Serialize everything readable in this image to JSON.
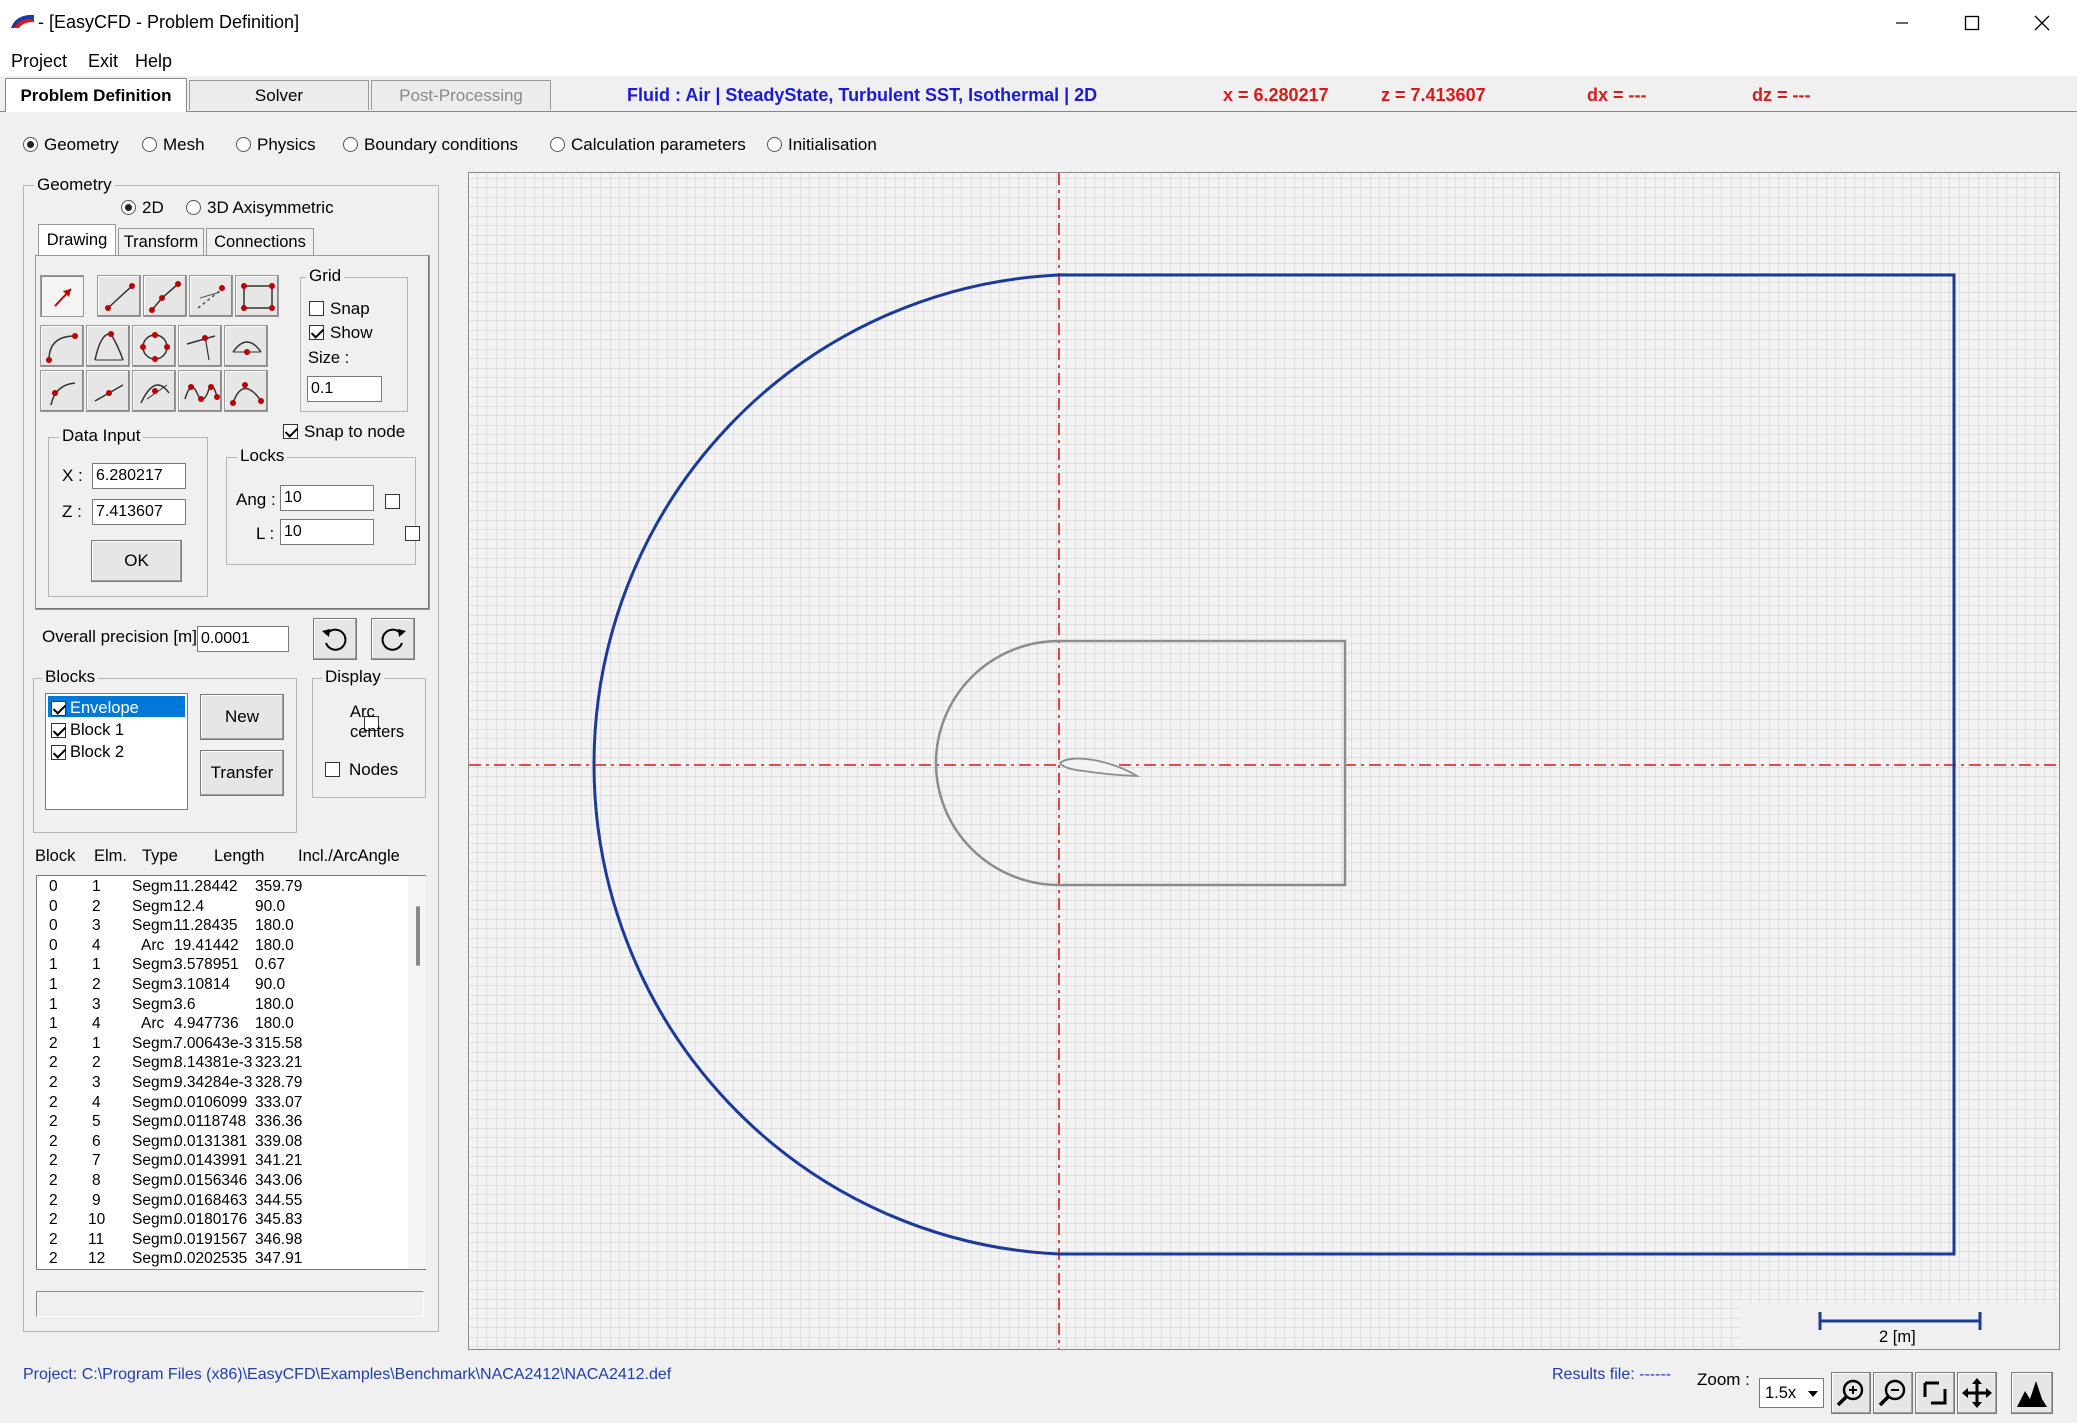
{
  "window": {
    "title": " - [EasyCFD - Problem Definition]",
    "minimize_icon": "minimize-icon",
    "maximize_icon": "maximize-icon",
    "close_icon": "close-icon"
  },
  "menubar": {
    "items": [
      "Project",
      "Exit",
      "Help"
    ]
  },
  "main_tabs": [
    {
      "label": "Problem Definition",
      "state": "active"
    },
    {
      "label": "Solver",
      "state": "normal"
    },
    {
      "label": "Post-Processing",
      "state": "disabled"
    }
  ],
  "status": {
    "fluid_info": "Fluid : Air  |  SteadyState, Turbulent SST, Isothermal  |  2D",
    "x": "x = 6.280217",
    "z": "z = 7.413607",
    "dx": "dx = ---",
    "dz": "dz = ---",
    "info_color": "#1a1ad8",
    "coord_color": "#d81a1a"
  },
  "sections": [
    {
      "label": "Geometry",
      "selected": true
    },
    {
      "label": "Mesh",
      "selected": false
    },
    {
      "label": "Physics",
      "selected": false
    },
    {
      "label": "Boundary conditions",
      "selected": false
    },
    {
      "label": "Calculation parameters",
      "selected": false
    },
    {
      "label": "Initialisation",
      "selected": false
    }
  ],
  "geometry": {
    "group_title": "Geometry",
    "mode_2d": "2D",
    "mode_3d": "3D Axisymmetric",
    "subtabs": [
      "Drawing",
      "Transform",
      "Connections"
    ],
    "tools": [
      "pointer-arrow-icon",
      "line-icon",
      "polyline-icon",
      "dashed-line-icon",
      "rectangle-icon",
      "arc-icon",
      "arc-three-point-icon",
      "circle-icon",
      "tangent-line-icon",
      "half-circle-icon",
      "curve-icon",
      "line-point-icon",
      "arc-through-icon",
      "spline-icon",
      "bezier-icon"
    ],
    "grid": {
      "title": "Grid",
      "snap_label": "Snap",
      "snap": false,
      "show_label": "Show",
      "show": true,
      "size_label": "Size :",
      "size_value": "0.1"
    },
    "snap_to_node_label": "Snap to node",
    "data_input": {
      "title": "Data Input",
      "x_label": "X :",
      "x_value": "6.280217",
      "z_label": "Z :",
      "z_value": "7.413607",
      "ok_label": "OK"
    },
    "locks": {
      "title": "Locks",
      "ang_label": "Ang :",
      "ang_value": "10",
      "l_label": "L :",
      "l_value": "10"
    }
  },
  "precision": {
    "label": "Overall precision [m] :",
    "value": "0.0001"
  },
  "blocks": {
    "title": "Blocks",
    "items": [
      {
        "name": "Envelope",
        "checked": true,
        "selected": true
      },
      {
        "name": "Block 1",
        "checked": true,
        "selected": false
      },
      {
        "name": "Block 2",
        "checked": true,
        "selected": false
      }
    ],
    "new_label": "New",
    "transfer_label": "Transfer"
  },
  "display": {
    "title": "Display",
    "arc_centers_label_1": "Arc",
    "arc_centers_label_2": "centers",
    "nodes_label": "Nodes"
  },
  "element_table": {
    "headers": [
      "Block",
      "Elm.",
      "Type",
      "Length",
      "Incl./ArcAngle"
    ],
    "rows": [
      [
        "0",
        "1",
        "Segm.",
        "11.28442",
        "359.79"
      ],
      [
        "0",
        "2",
        "Segm.",
        "12.4",
        "90.0"
      ],
      [
        "0",
        "3",
        "Segm.",
        "11.28435",
        "180.0"
      ],
      [
        "0",
        "4",
        "Arc",
        "19.41442",
        "180.0"
      ],
      [
        "1",
        "1",
        "Segm.",
        "3.578951",
        "0.67"
      ],
      [
        "1",
        "2",
        "Segm.",
        "3.10814",
        "90.0"
      ],
      [
        "1",
        "3",
        "Segm.",
        "3.6",
        "180.0"
      ],
      [
        "1",
        "4",
        "Arc",
        "4.947736",
        "180.0"
      ],
      [
        "2",
        "1",
        "Segm.",
        "7.00643e-3",
        "315.58"
      ],
      [
        "2",
        "2",
        "Segm.",
        "8.14381e-3",
        "323.21"
      ],
      [
        "2",
        "3",
        "Segm.",
        "9.34284e-3",
        "328.79"
      ],
      [
        "2",
        "4",
        "Segm.",
        "0.0106099",
        "333.07"
      ],
      [
        "2",
        "5",
        "Segm.",
        "0.0118748",
        "336.36"
      ],
      [
        "2",
        "6",
        "Segm.",
        "0.0131381",
        "339.08"
      ],
      [
        "2",
        "7",
        "Segm.",
        "0.0143991",
        "341.21"
      ],
      [
        "2",
        "8",
        "Segm.",
        "0.0156346",
        "343.06"
      ],
      [
        "2",
        "9",
        "Segm.",
        "0.0168463",
        "344.55"
      ],
      [
        "2",
        "10",
        "Segm.",
        "0.0180176",
        "345.83"
      ],
      [
        "2",
        "11",
        "Segm.",
        "0.0191567",
        "346.98"
      ],
      [
        "2",
        "12",
        "Segm.",
        "0.0202535",
        "347.91"
      ]
    ]
  },
  "canvas": {
    "scale_label": "2  [m]",
    "envelope_color": "#1c3a99",
    "block_color": "#8c8c8c",
    "axis_color": "#d81a1a"
  },
  "footer": {
    "project_path": "Project: C:\\Program Files (x86)\\EasyCFD\\Examples\\Benchmark\\NACA2412\\NACA2412.def",
    "results_label": "Results file: ------",
    "zoom_label": "Zoom :",
    "zoom_value": "1.5x"
  }
}
